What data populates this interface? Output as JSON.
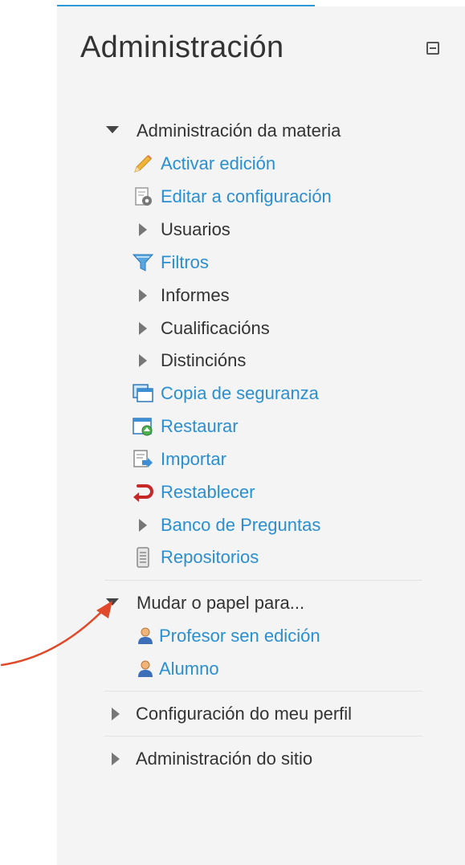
{
  "block": {
    "title": "Administración",
    "collapse_label": "collapse"
  },
  "course_admin": {
    "heading": "Administración da materia",
    "items": [
      {
        "label": "Activar edición",
        "icon": "pencil-icon",
        "type": "link"
      },
      {
        "label": "Editar a configuración",
        "icon": "settings-document-icon",
        "type": "link"
      },
      {
        "label": "Usuarios",
        "icon": "expand-arrow-icon",
        "type": "branch"
      },
      {
        "label": "Filtros",
        "icon": "funnel-icon",
        "type": "link"
      },
      {
        "label": "Informes",
        "icon": "expand-arrow-icon",
        "type": "branch"
      },
      {
        "label": "Cualificacións",
        "icon": "expand-arrow-icon",
        "type": "branch"
      },
      {
        "label": "Distincións",
        "icon": "expand-arrow-icon",
        "type": "branch"
      },
      {
        "label": "Copia de seguranza",
        "icon": "backup-icon",
        "type": "link"
      },
      {
        "label": "Restaurar",
        "icon": "restore-icon",
        "type": "link"
      },
      {
        "label": "Importar",
        "icon": "import-icon",
        "type": "link"
      },
      {
        "label": "Restablecer",
        "icon": "reset-icon",
        "type": "link"
      },
      {
        "label": "Banco de Preguntas",
        "icon": "expand-arrow-icon",
        "type": "branch-link"
      },
      {
        "label": "Repositorios",
        "icon": "repository-icon",
        "type": "link"
      }
    ]
  },
  "switch_role": {
    "heading": "Mudar o papel para...",
    "items": [
      {
        "label": "Profesor sen edición",
        "icon": "user-icon"
      },
      {
        "label": "Alumno",
        "icon": "user-icon"
      }
    ]
  },
  "profile_settings": {
    "label": "Configuración do meu perfil"
  },
  "site_admin": {
    "label": "Administración do sitio"
  },
  "colors": {
    "accent": "#2a9ad8",
    "link": "#2a8fd0",
    "text": "#333333",
    "annotation_arrow": "#e04a2a"
  }
}
